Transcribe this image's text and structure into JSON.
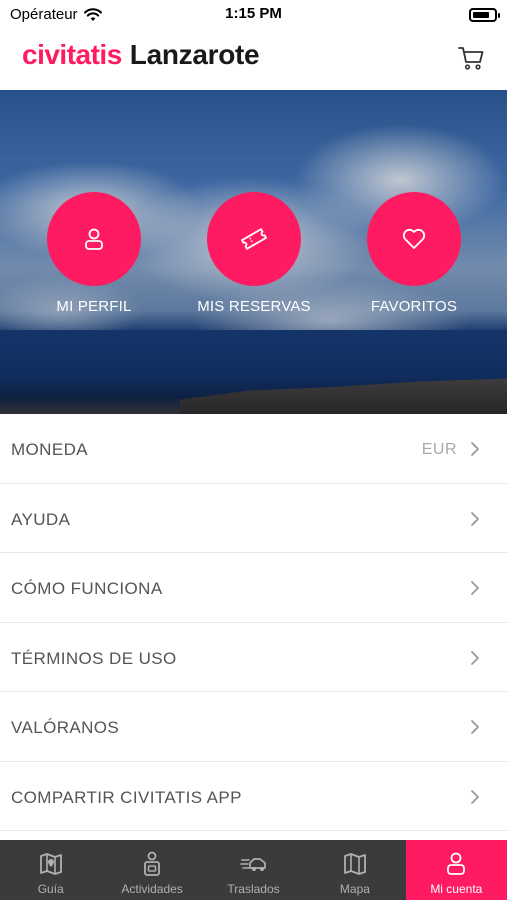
{
  "status_bar": {
    "carrier": "Opérateur",
    "time": "1:15 PM",
    "battery_level": 0.8
  },
  "header": {
    "logo": "civitatis",
    "city": "Lanzarote",
    "cart_icon": "cart-icon"
  },
  "quick_actions": [
    {
      "label": "MI PERFIL",
      "icon": "user-icon"
    },
    {
      "label": "MIS RESERVAS",
      "icon": "ticket-icon"
    },
    {
      "label": "FAVORITOS",
      "icon": "heart-icon"
    }
  ],
  "menu": [
    {
      "label": "MONEDA",
      "value": "EUR"
    },
    {
      "label": "AYUDA"
    },
    {
      "label": "CÓMO FUNCIONA"
    },
    {
      "label": "TÉRMINOS DE USO"
    },
    {
      "label": "VALÓRANOS"
    },
    {
      "label": "COMPARTIR CIVITATIS APP"
    }
  ],
  "tabs": [
    {
      "label": "Guía",
      "icon": "guide-map-icon",
      "active": false
    },
    {
      "label": "Actividades",
      "icon": "activities-icon",
      "active": false
    },
    {
      "label": "Traslados",
      "icon": "transfer-car-icon",
      "active": false
    },
    {
      "label": "Mapa",
      "icon": "map-icon",
      "active": false
    },
    {
      "label": "Mi cuenta",
      "icon": "account-icon",
      "active": true
    }
  ],
  "colors": {
    "brand": "#ff1b61",
    "tab_bar": "#3b3b3b"
  }
}
